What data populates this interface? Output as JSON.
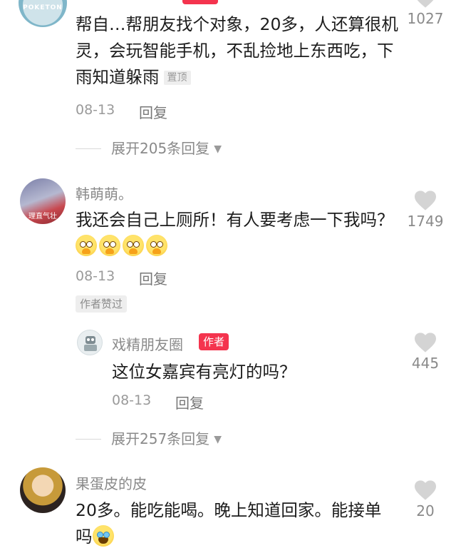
{
  "comments": [
    {
      "avatar_text": "POKETON",
      "text": "帮自…帮朋友找个对象，20多，人还算很机灵，会玩智能手机，不乱捡地上东西吃，下雨知道躲雨",
      "pinned_tag": "置顶",
      "date": "08-13",
      "reply_label": "回复",
      "likes": "1027",
      "expand_label": "展开205条回复"
    },
    {
      "username": "韩萌萌。",
      "avatar_text": "理直气壮",
      "text": "我还会自己上厕所！有人要考虑一下我吗？",
      "emoji_names": [
        "pleading-face-emoji",
        "pleading-face-emoji",
        "pleading-face-emoji",
        "pleading-face-emoji"
      ],
      "date": "08-13",
      "reply_label": "回复",
      "likes": "1749",
      "author_liked_tag": "作者赞过",
      "reply": {
        "username": "戏精朋友圈",
        "author_tag": "作者",
        "text": "这位女嘉宾有亮灯的吗？",
        "date": "08-13",
        "reply_label": "回复",
        "likes": "445"
      },
      "expand_label": "展开257条回复"
    },
    {
      "username": "果蛋皮的皮",
      "text": "20多。能吃能喝。晚上知道回家。能接单吗",
      "emoji_names": [
        "crying-face-emoji"
      ],
      "likes": "20"
    }
  ],
  "colors": {
    "accent_red": "#f4344e",
    "muted_text": "#8a8a8a",
    "like_heart": "#d4d4d4"
  },
  "icons": {
    "like": "heart-icon",
    "expand": "chevron-down-icon"
  }
}
